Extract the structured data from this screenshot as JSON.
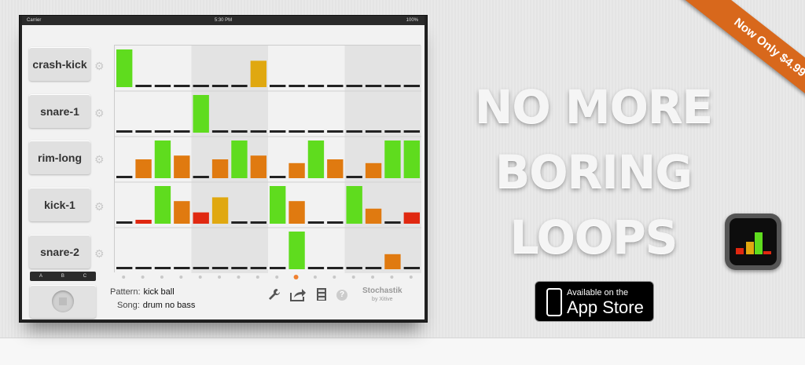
{
  "device": {
    "carrier": "Carrier",
    "time": "5:30 PM",
    "battery": "100%"
  },
  "tracks": [
    {
      "label": "crash-kick",
      "steps": [
        10,
        0,
        0,
        0,
        0,
        0,
        0,
        7,
        0,
        0,
        0,
        0,
        0,
        0,
        0,
        0
      ]
    },
    {
      "label": "snare-1",
      "steps": [
        0,
        0,
        0,
        0,
        10,
        0,
        0,
        0,
        0,
        0,
        0,
        0,
        0,
        0,
        0,
        0
      ]
    },
    {
      "label": "rim-long",
      "steps": [
        0,
        5,
        10,
        6,
        0,
        5,
        10,
        6,
        0,
        4,
        10,
        5,
        0,
        4,
        10,
        10
      ]
    },
    {
      "label": "kick-1",
      "steps": [
        0,
        1,
        10,
        6,
        3,
        7,
        0,
        0,
        10,
        6,
        0,
        0,
        10,
        4,
        0,
        3
      ]
    },
    {
      "label": "snare-2",
      "steps": [
        0,
        0,
        0,
        0,
        0,
        0,
        0,
        0,
        0,
        10,
        0,
        0,
        0,
        0,
        4,
        0
      ]
    }
  ],
  "bank_tabs": [
    "A",
    "B",
    "C"
  ],
  "pattern": {
    "label": "Pattern:",
    "value": "kick ball"
  },
  "song": {
    "label": "Song:",
    "value": "drum no bass"
  },
  "brand": {
    "name": "Stochastik",
    "by": "by Xitive"
  },
  "icons": [
    "gear-icon",
    "wrench-icon",
    "share-icon",
    "cabinet-icon",
    "help-icon",
    "stop-icon"
  ],
  "help_glyph": "?",
  "headline": [
    "NO MORE",
    "BORING",
    "LOOPS"
  ],
  "ribbon": "Now Only $4.99",
  "appstore": {
    "small": "Available on the",
    "big": "App Store"
  },
  "colors": {
    "green": "#5fdc1e",
    "orange": "#e07a10",
    "amber": "#e0a810",
    "red": "#e02810",
    "ribbon": "#d8681c"
  }
}
